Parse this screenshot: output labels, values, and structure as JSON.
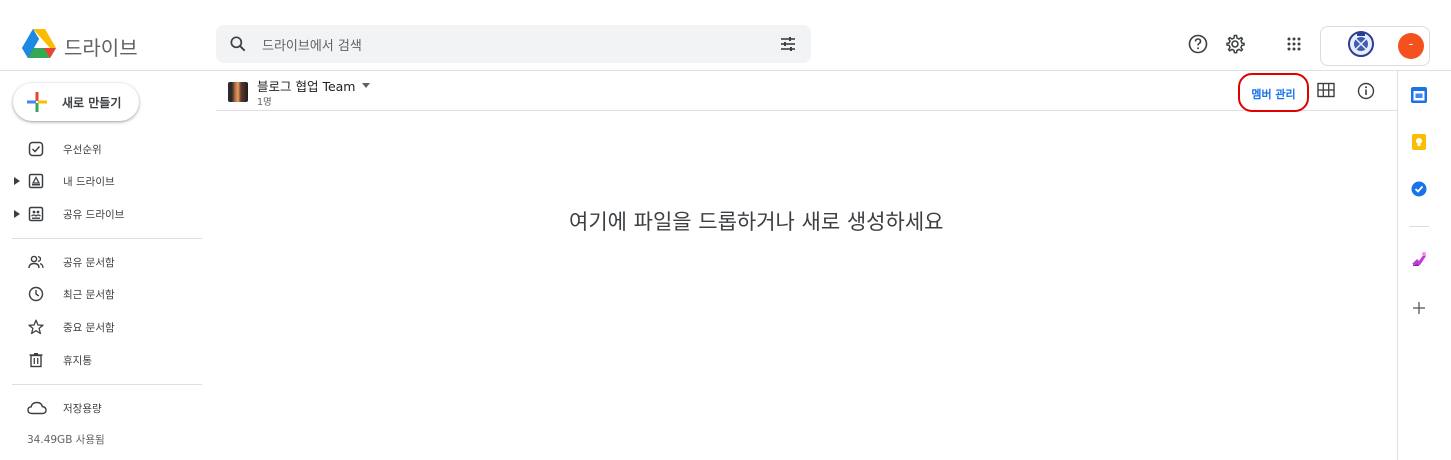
{
  "header": {
    "app_name": "드라이브",
    "search": {
      "placeholder": "드라이브에서 검색"
    },
    "avatar_initial": "-"
  },
  "sidebar": {
    "new_button_label": "새로 만들기",
    "items": [
      {
        "label": "우선순위",
        "icon": "priority-icon"
      },
      {
        "label": "내 드라이브",
        "icon": "my-drive-icon",
        "expandable": true
      },
      {
        "label": "공유 드라이브",
        "icon": "shared-drives-icon",
        "expandable": true
      },
      {
        "label": "공유 문서함",
        "icon": "shared-with-me-icon"
      },
      {
        "label": "최근 문서함",
        "icon": "recent-icon"
      },
      {
        "label": "중요 문서함",
        "icon": "starred-icon"
      },
      {
        "label": "휴지통",
        "icon": "trash-icon"
      },
      {
        "label": "저장용량",
        "icon": "cloud-icon"
      }
    ],
    "storage_used": "34.49GB 사용됨"
  },
  "main": {
    "drive_name": "블로그 협업 Team",
    "member_count": "1명",
    "manage_members_label": "멤버 관리",
    "empty_message": "여기에 파일을 드롭하거나 새로 생성하세요"
  },
  "colors": {
    "accent_blue": "#1a73e8",
    "highlight_red": "#e00000",
    "avatar_orange": "#f4511e"
  }
}
